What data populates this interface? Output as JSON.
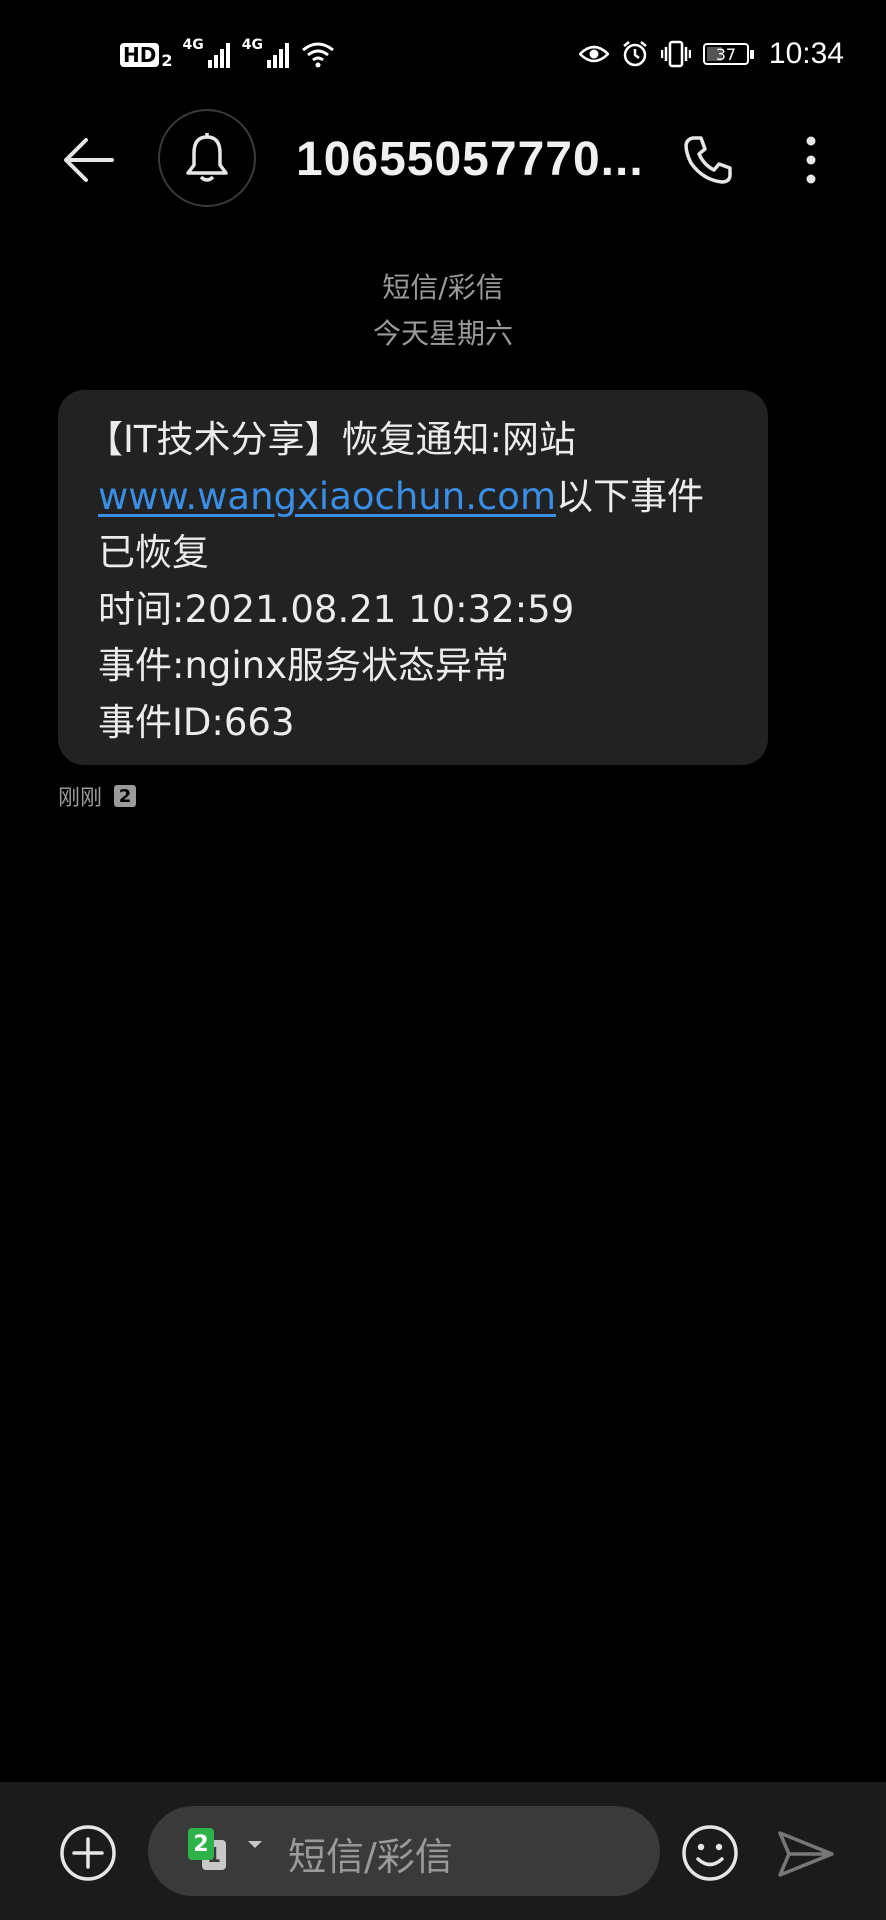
{
  "status_bar": {
    "hd_label": "HD",
    "hd_sim": "2",
    "net1": "4G",
    "net2": "4G",
    "battery_level": "37",
    "time": "10:34"
  },
  "header": {
    "title": "10655057770..."
  },
  "thread": {
    "type_label": "短信/彩信",
    "date_label": "今天星期六"
  },
  "message": {
    "line1": "【IT技术分享】恢复通知:网站",
    "link": "www.wangxiaochun.com",
    "line2_suffix": "以下事件",
    "line3": "已恢复",
    "line4": "时间:2021.08.21 10:32:59",
    "line5": "事件:nginx服务状态异常",
    "line6": "事件ID:663",
    "time_label": "刚刚",
    "sim_label": "2"
  },
  "composer": {
    "sim_primary": "2",
    "sim_secondary": "1",
    "placeholder": "短信/彩信"
  },
  "colors": {
    "background": "#000000",
    "bubble": "#222222",
    "link": "#3a8ee6",
    "sim_active": "#2db34a",
    "input_bar": "#1b1b1b"
  },
  "icons": [
    "back-arrow-icon",
    "bell-icon",
    "phone-icon",
    "more-vert-icon",
    "add-icon",
    "emoji-icon",
    "send-icon",
    "wifi-icon",
    "eye-icon",
    "alarm-icon",
    "vibrate-icon",
    "signal-icon",
    "battery-icon"
  ]
}
